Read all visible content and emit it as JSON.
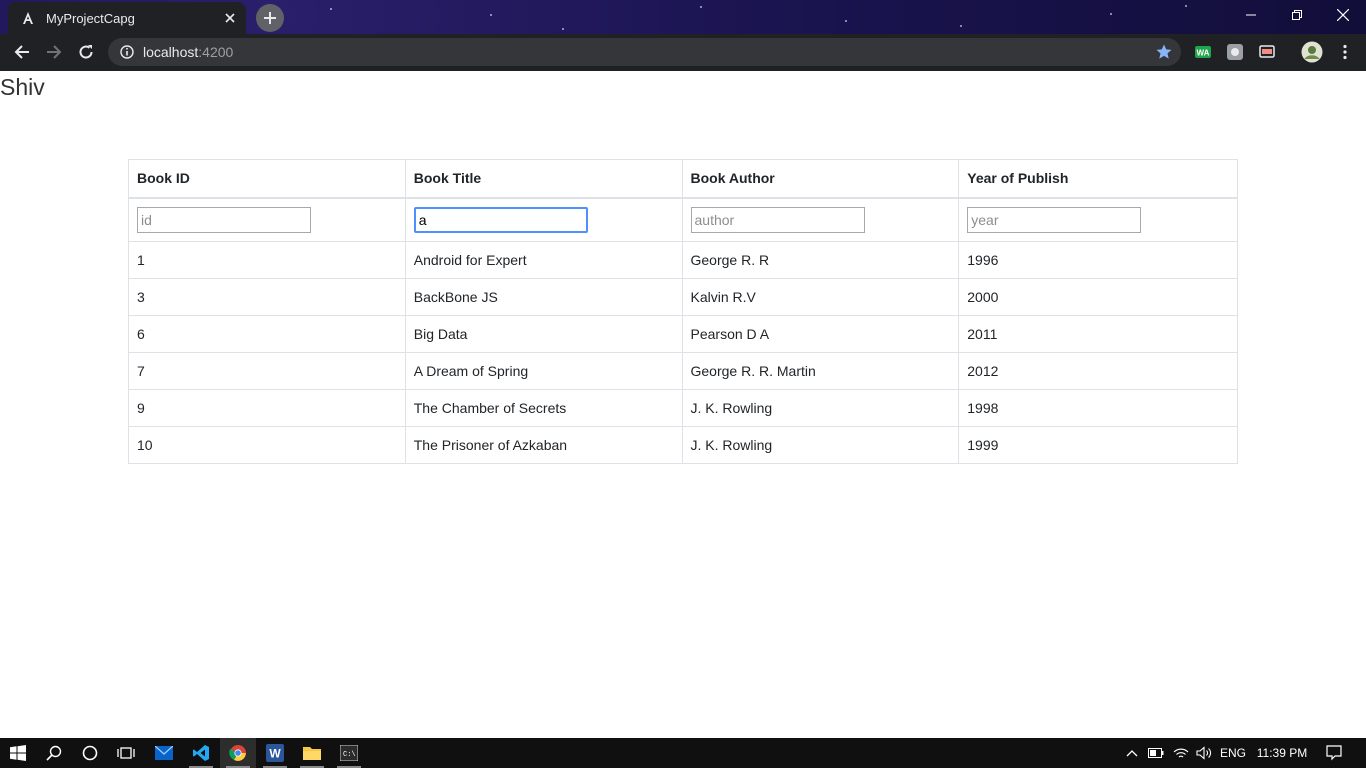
{
  "browser": {
    "tab_title": "MyProjectCapg",
    "url_host": "localhost",
    "url_port": ":4200"
  },
  "page": {
    "heading": "Shiv",
    "table": {
      "headers": [
        "Book ID",
        "Book Title",
        "Book Author",
        "Year of Publish"
      ],
      "filters": {
        "id": {
          "value": "",
          "placeholder": "id"
        },
        "title": {
          "value": "a",
          "placeholder": ""
        },
        "author": {
          "value": "",
          "placeholder": "author"
        },
        "year": {
          "value": "",
          "placeholder": "year"
        }
      },
      "rows": [
        {
          "id": "1",
          "title": "Android for Expert",
          "author": "George R. R",
          "year": "1996"
        },
        {
          "id": "3",
          "title": "BackBone JS",
          "author": "Kalvin R.V",
          "year": "2000"
        },
        {
          "id": "6",
          "title": "Big Data",
          "author": "Pearson D A",
          "year": "2011"
        },
        {
          "id": "7",
          "title": "A Dream of Spring",
          "author": "George R. R. Martin",
          "year": "2012"
        },
        {
          "id": "9",
          "title": "The Chamber of Secrets",
          "author": "J. K. Rowling",
          "year": "1998"
        },
        {
          "id": "10",
          "title": "The Prisoner of Azkaban",
          "author": "J. K. Rowling",
          "year": "1999"
        }
      ]
    }
  },
  "taskbar": {
    "language": "ENG",
    "time": "11:39 PM"
  },
  "colors": {
    "tab_bg": "#202124",
    "omnibox_bg": "#35363a",
    "focus_border": "#4d90fe",
    "taskbar_bg": "#101010"
  }
}
